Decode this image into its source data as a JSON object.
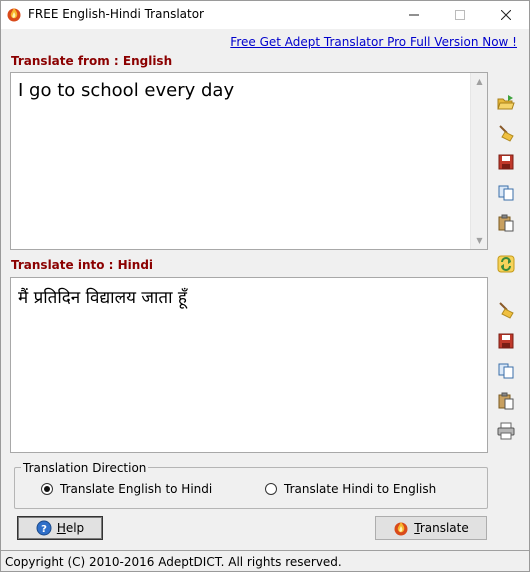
{
  "window": {
    "title": "FREE English-Hindi Translator",
    "app_icon": "flame-icon"
  },
  "promo": {
    "link_text": "Free Get Adept Translator Pro Full Version Now !"
  },
  "source": {
    "label": "Translate from : English",
    "text": "I go to school every day"
  },
  "target": {
    "label": "Translate into : Hindi",
    "text": "मैं प्रतिदिन विद्यालय जाता हूँ"
  },
  "toolbar_source": [
    "open-folder-icon",
    "clear-broom-icon",
    "save-disk-icon",
    "copy-icon",
    "paste-icon"
  ],
  "swap_icon": "swap-refresh-icon",
  "toolbar_target": [
    "clear-broom-icon",
    "save-disk-icon",
    "copy-icon",
    "paste-icon",
    "print-icon"
  ],
  "direction": {
    "legend": "Translation Direction",
    "options": [
      {
        "label": "Translate English to Hindi",
        "selected": true
      },
      {
        "label": "Translate Hindi to English",
        "selected": false
      }
    ]
  },
  "buttons": {
    "help_mnemonic": "H",
    "help_rest": "elp",
    "translate_mnemonic": "T",
    "translate_rest": "ranslate"
  },
  "status": {
    "text": "Copyright (C) 2010-2016 AdeptDICT. All rights reserved."
  },
  "colors": {
    "label": "#8b0000",
    "link": "#0000cc"
  }
}
